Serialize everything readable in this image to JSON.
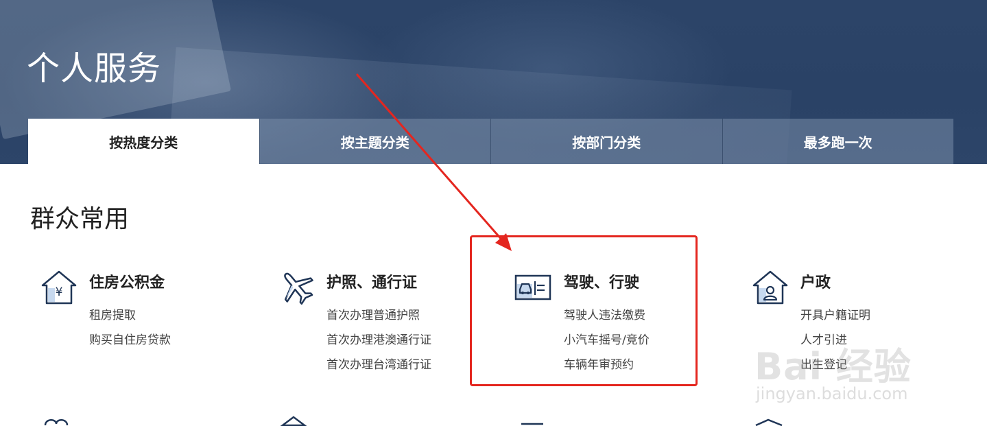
{
  "page": {
    "title": "个人服务",
    "section_title": "群众常用"
  },
  "tabs": [
    {
      "label": "按热度分类",
      "active": true
    },
    {
      "label": "按主题分类",
      "active": false
    },
    {
      "label": "按部门分类",
      "active": false
    },
    {
      "label": "最多跑一次",
      "active": false
    }
  ],
  "categories": [
    {
      "title": "住房公积金",
      "icon": "house-yen-icon",
      "links": [
        "租房提取",
        "购买自住房贷款"
      ]
    },
    {
      "title": "护照、通行证",
      "icon": "airplane-icon",
      "links": [
        "首次办理普通护照",
        "首次办理港澳通行证",
        "首次办理台湾通行证"
      ]
    },
    {
      "title": "驾驶、行驶",
      "icon": "driving-license-icon",
      "links": [
        "驾驶人违法缴费",
        "小汽车摇号/竞价",
        "车辆年审预约"
      ]
    },
    {
      "title": "户政",
      "icon": "house-person-icon",
      "links": [
        "开具户籍证明",
        "人才引进",
        "出生登记"
      ]
    }
  ],
  "watermark": {
    "main": "Bai 经验",
    "sub": "jingyan.baidu.com"
  },
  "colors": {
    "accent_red": "#e4261f",
    "icon_navy": "#1f3556",
    "icon_light_blue": "#c7d9ef",
    "hero_bg": "#2c4468"
  }
}
